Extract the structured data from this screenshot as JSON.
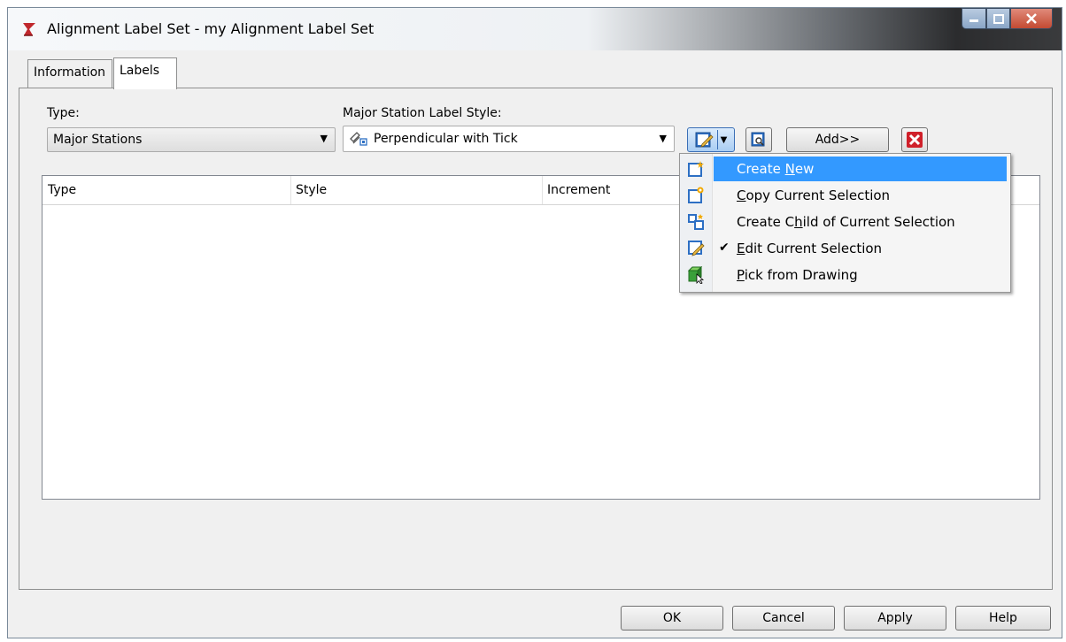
{
  "window": {
    "title": "Alignment Label Set - my Alignment Label Set"
  },
  "tabs": [
    {
      "label": "Information",
      "selected": false
    },
    {
      "label": "Labels",
      "selected": true
    }
  ],
  "type_field": {
    "label": "Type:",
    "value": "Major Stations"
  },
  "style_field": {
    "label": "Major Station Label Style:",
    "value": "Perpendicular with Tick"
  },
  "toolbar": {
    "add_label": "Add>>"
  },
  "grid": {
    "columns": [
      "Type",
      "Style",
      "Increment"
    ],
    "rows": []
  },
  "context_menu": {
    "items": [
      {
        "pre": "Create ",
        "mnemonic": "N",
        "post": "ew",
        "icon": "create-new-icon",
        "highlighted": true,
        "checked": false
      },
      {
        "pre": "",
        "mnemonic": "C",
        "post": "opy Current Selection",
        "icon": "copy-selection-icon",
        "highlighted": false,
        "checked": false
      },
      {
        "pre": "Create C",
        "mnemonic": "h",
        "post": "ild of Current Selection",
        "icon": "create-child-icon",
        "highlighted": false,
        "checked": false
      },
      {
        "pre": "",
        "mnemonic": "E",
        "post": "dit Current Selection",
        "icon": "edit-selection-icon",
        "highlighted": false,
        "checked": true
      },
      {
        "pre": "",
        "mnemonic": "P",
        "post": "ick from Drawing",
        "icon": "pick-from-drawing-icon",
        "highlighted": false,
        "checked": false
      }
    ],
    "check_glyph": "✔"
  },
  "footer": {
    "ok": "OK",
    "cancel": "Cancel",
    "apply": "Apply",
    "help": "Help"
  },
  "colors": {
    "highlight": "#3399ff",
    "delete_red": "#d0202a",
    "icon_blue": "#2d6fc4"
  }
}
